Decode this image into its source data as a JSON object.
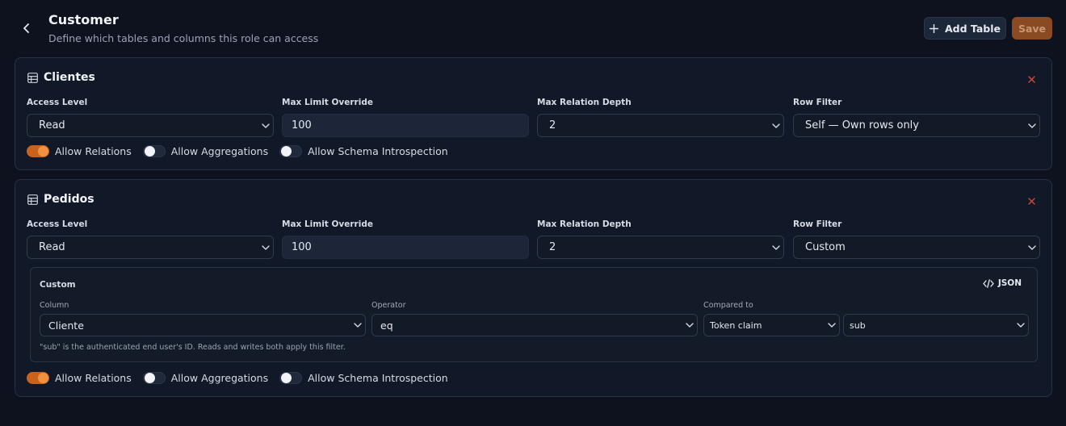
{
  "header": {
    "title": "Customer",
    "subtitle": "Define which tables and columns this role can access",
    "add_table_label": "Add Table",
    "save_label": "Save"
  },
  "colors": {
    "background": "#0d121e",
    "accent": "#c7631d",
    "danger": "#d0493a"
  },
  "labels": {
    "access_level": "Access Level",
    "max_limit": "Max Limit Override",
    "max_depth": "Max Relation Depth",
    "row_filter": "Row Filter",
    "allow_relations": "Allow Relations",
    "allow_aggregations": "Allow Aggregations",
    "allow_introspection": "Allow Schema Introspection"
  },
  "tables": [
    {
      "name": "Clientes",
      "access_level": "Read",
      "max_limit": "100",
      "max_depth": "2",
      "row_filter": "Self — Own rows only",
      "allow_relations": true,
      "allow_aggregations": false,
      "allow_introspection": false
    },
    {
      "name": "Pedidos",
      "access_level": "Read",
      "max_limit": "100",
      "max_depth": "2",
      "row_filter": "Custom",
      "allow_relations": true,
      "allow_aggregations": false,
      "allow_introspection": false,
      "custom_filter": {
        "title": "Custom",
        "json_label": "JSON",
        "column_label": "Column",
        "column_value": "Cliente",
        "operator_label": "Operator",
        "operator_value": "eq",
        "compared_label": "Compared to",
        "compared_type": "Token claim",
        "compared_value": "sub",
        "hint": "\"sub\" is the authenticated end user's ID. Reads and writes both apply this filter."
      }
    }
  ],
  "icons": {
    "back": "chevron-left-icon",
    "add": "plus-icon",
    "table": "table-icon",
    "close": "close-icon",
    "dropdown": "chevron-down-icon",
    "json": "code-icon"
  }
}
